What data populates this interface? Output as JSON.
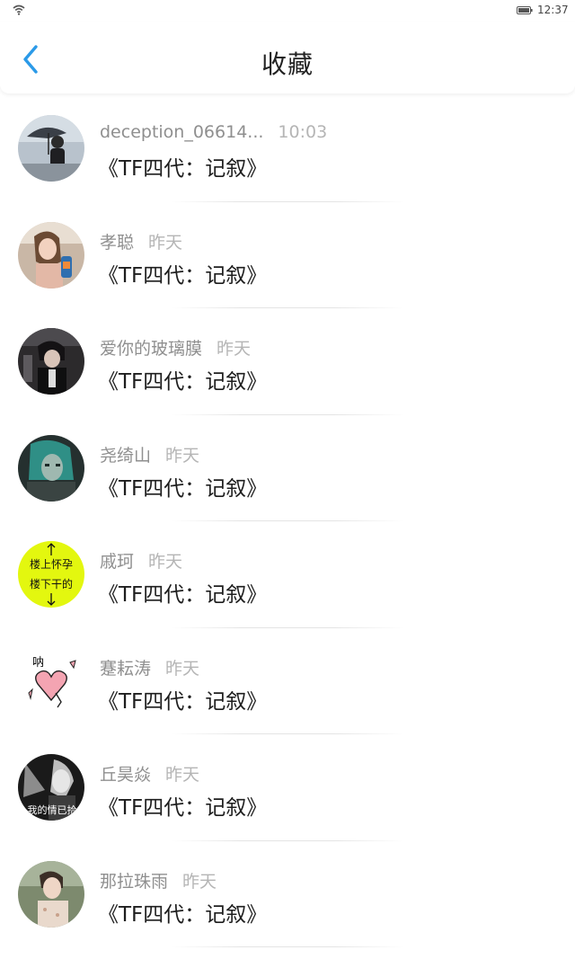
{
  "status_bar": {
    "time": "12:37",
    "wifi_icon": "wifi-icon",
    "battery_icon": "battery-icon"
  },
  "header": {
    "title": "收藏",
    "back_icon": "chevron-left-icon",
    "accent_color": "#2b9ae8"
  },
  "messages": [
    {
      "name": "deception_06614...",
      "time": "10:03",
      "text": "《TF四代：记叙》",
      "avatar": "photo-person-umbrella"
    },
    {
      "name": "孝聪",
      "time": "昨天",
      "text": "《TF四代：记叙》",
      "avatar": "photo-girl-bottle"
    },
    {
      "name": "爱你的玻璃膜",
      "time": "昨天",
      "text": "《TF四代：记叙》",
      "avatar": "photo-dark-figure"
    },
    {
      "name": "尧绮山",
      "time": "昨天",
      "text": "《TF四代：记叙》",
      "avatar": "photo-animated-character"
    },
    {
      "name": "戚珂",
      "time": "昨天",
      "text": "《TF四代：记叙》",
      "avatar": "text-avatar",
      "avatar_text": [
        "楼上怀孕",
        "楼下干的"
      ]
    },
    {
      "name": "蹇耘涛",
      "time": "昨天",
      "text": "《TF四代：记叙》",
      "avatar": "heart-sticker",
      "avatar_text": [
        "呐"
      ]
    },
    {
      "name": "丘昊焱",
      "time": "昨天",
      "text": "《TF四代：记叙》",
      "avatar": "bw-photo",
      "avatar_text": [
        "我的情已拾"
      ]
    },
    {
      "name": "那拉珠雨",
      "time": "昨天",
      "text": "《TF四代：记叙》",
      "avatar": "photo-person-field"
    }
  ]
}
